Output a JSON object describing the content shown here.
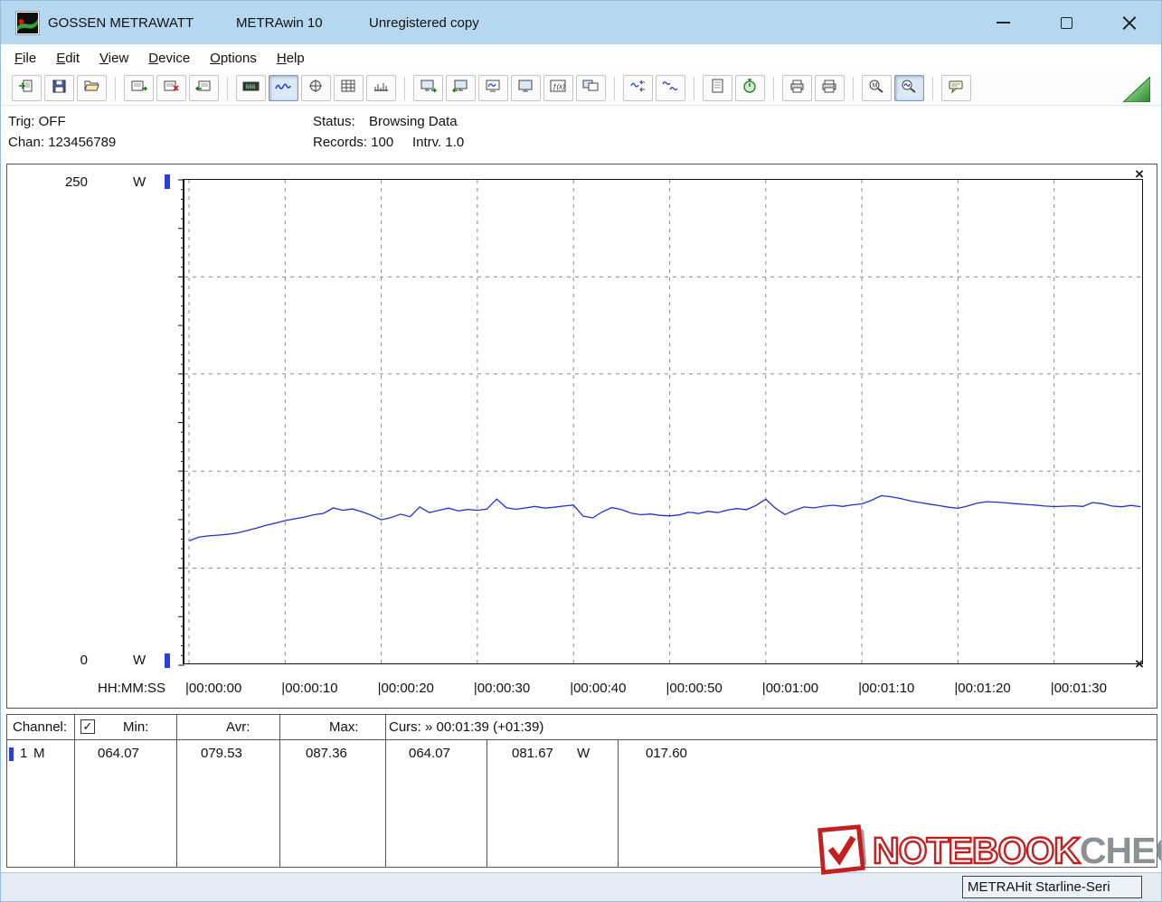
{
  "colors": {
    "titlebar_bg": "#b5d8f0",
    "chart_line": "#2233cc",
    "marker_blue": "#2b3fd6",
    "grid": "#8a8a8a",
    "nbc_red": "#c41f1f",
    "nbc_gray": "#8f9093",
    "triangle_green": "#1e8c1e"
  },
  "titlebar": {
    "brand": "GOSSEN METRAWATT",
    "app": "METRAwin 10",
    "license": "Unregistered copy"
  },
  "menu": {
    "items": [
      {
        "label": "File"
      },
      {
        "label": "Edit"
      },
      {
        "label": "View"
      },
      {
        "label": "Device"
      },
      {
        "label": "Options"
      },
      {
        "label": "Help"
      }
    ]
  },
  "toolbar": {
    "items": [
      {
        "name": "open-file-button",
        "icon": "doc-in"
      },
      {
        "name": "save-file-button",
        "icon": "disk"
      },
      {
        "name": "browse-file-button",
        "icon": "folder"
      },
      {
        "type": "sep"
      },
      {
        "name": "read-device-memory-button",
        "icon": "card-in"
      },
      {
        "name": "clear-device-memory-button",
        "icon": "card-x"
      },
      {
        "name": "write-device-memory-button",
        "icon": "card-out"
      },
      {
        "type": "sep"
      },
      {
        "name": "multimeter-display-button",
        "icon": "lcd"
      },
      {
        "name": "yt-chart-view-button",
        "icon": "wave",
        "pressed": true
      },
      {
        "name": "xy-chart-view-button",
        "icon": "crosshair"
      },
      {
        "name": "data-table-view-button",
        "icon": "table"
      },
      {
        "name": "statistics-view-button",
        "icon": "ruler"
      },
      {
        "type": "sep"
      },
      {
        "name": "export-screen-button",
        "icon": "screen-out"
      },
      {
        "name": "import-screen-button",
        "icon": "screen-in"
      },
      {
        "name": "configure-chart-button",
        "icon": "screen-wave"
      },
      {
        "name": "monitor-button",
        "icon": "screen"
      },
      {
        "name": "formula-button",
        "icon": "fx"
      },
      {
        "name": "copy-screen-button",
        "icon": "screen-copy"
      },
      {
        "type": "sep"
      },
      {
        "name": "compress-curve-button",
        "icon": "wave-arrows"
      },
      {
        "name": "split-curve-button",
        "icon": "wave-small"
      },
      {
        "type": "sep"
      },
      {
        "name": "notes-button",
        "icon": "note"
      },
      {
        "name": "timer-button",
        "icon": "stopwatch"
      },
      {
        "type": "sep"
      },
      {
        "name": "print-preview-button",
        "icon": "printer-view"
      },
      {
        "name": "print-button",
        "icon": "printer"
      },
      {
        "type": "sep"
      },
      {
        "name": "zoom-100-button",
        "icon": "zoom-m"
      },
      {
        "name": "zoom-curve-button",
        "icon": "zoom-wave",
        "pressed": true
      },
      {
        "type": "sep"
      },
      {
        "name": "hints-button",
        "icon": "callout"
      }
    ]
  },
  "status_panel": {
    "trig": "Trig: OFF",
    "chan": "Chan: 123456789",
    "status_label": "Status:",
    "status_value": "Browsing Data",
    "records": "Records: 100",
    "interval": "Intrv. 1.0"
  },
  "chart_ui": {
    "cursor_end_symbol": "×",
    "check_glyph": "✓"
  },
  "chart_data": {
    "type": "line",
    "title": "",
    "ylabel": "W",
    "ylim": [
      0,
      250
    ],
    "y_gridlines": [
      50,
      100,
      150,
      200
    ],
    "grid": "dashed",
    "x_axis_label": "HH:MM:SS",
    "x_tick_labels": [
      "00:00:00",
      "00:00:10",
      "00:00:20",
      "00:00:30",
      "00:00:40",
      "00:00:50",
      "00:01:00",
      "00:01:10",
      "00:01:20",
      "00:01:30"
    ],
    "x_interval_s": 10,
    "sample_interval_s": 1.0,
    "records": 100,
    "series": [
      {
        "name": "Channel 1",
        "unit": "W",
        "color": "#2233cc",
        "min": 64.07,
        "avg": 79.53,
        "max": 87.36,
        "values": [
          64.07,
          65.9,
          66.6,
          67.0,
          67.4,
          68.1,
          69.3,
          70.6,
          72.0,
          73.2,
          74.5,
          75.4,
          76.3,
          77.5,
          78.2,
          81.0,
          79.8,
          80.5,
          79.0,
          77.2,
          74.9,
          76.0,
          77.8,
          76.5,
          81.5,
          78.6,
          79.8,
          80.9,
          79.5,
          80.2,
          79.8,
          80.4,
          85.6,
          81.2,
          80.3,
          81.0,
          81.8,
          80.9,
          81.4,
          82.0,
          82.5,
          76.8,
          75.9,
          79.0,
          81.2,
          80.1,
          78.3,
          77.5,
          77.9,
          77.2,
          76.9,
          77.4,
          78.8,
          78.1,
          79.3,
          78.6,
          79.9,
          80.7,
          80.1,
          82.3,
          85.5,
          80.9,
          77.6,
          79.8,
          81.5,
          81.0,
          81.9,
          82.4,
          81.8,
          82.6,
          83.1,
          84.9,
          87.36,
          86.8,
          85.9,
          84.7,
          83.8,
          83.0,
          82.2,
          81.4,
          80.8,
          82.0,
          83.5,
          84.2,
          84.0,
          83.6,
          83.2,
          82.8,
          82.5,
          82.0,
          81.7,
          81.9,
          82.1,
          81.8,
          83.8,
          83.2,
          82.0,
          81.6,
          82.3,
          81.67
        ]
      }
    ]
  },
  "table": {
    "header": {
      "channel": "Channel:",
      "min": "Min:",
      "avr": "Avr:",
      "max": "Max:",
      "curs": "Curs: » 00:01:39 (+01:39)",
      "checkbox_checked": true
    },
    "row": {
      "channel": "1",
      "mode": "M",
      "min": "064.07",
      "avr": "079.53",
      "max": "087.36",
      "curs_a": "064.07",
      "curs_b": "081.67",
      "unit": "W",
      "delta": "017.60"
    }
  },
  "watermark": {
    "word1": "NOTEBOOK",
    "word2": "CHECK"
  },
  "statusbar": {
    "device": "METRAHit Starline-Seri"
  }
}
